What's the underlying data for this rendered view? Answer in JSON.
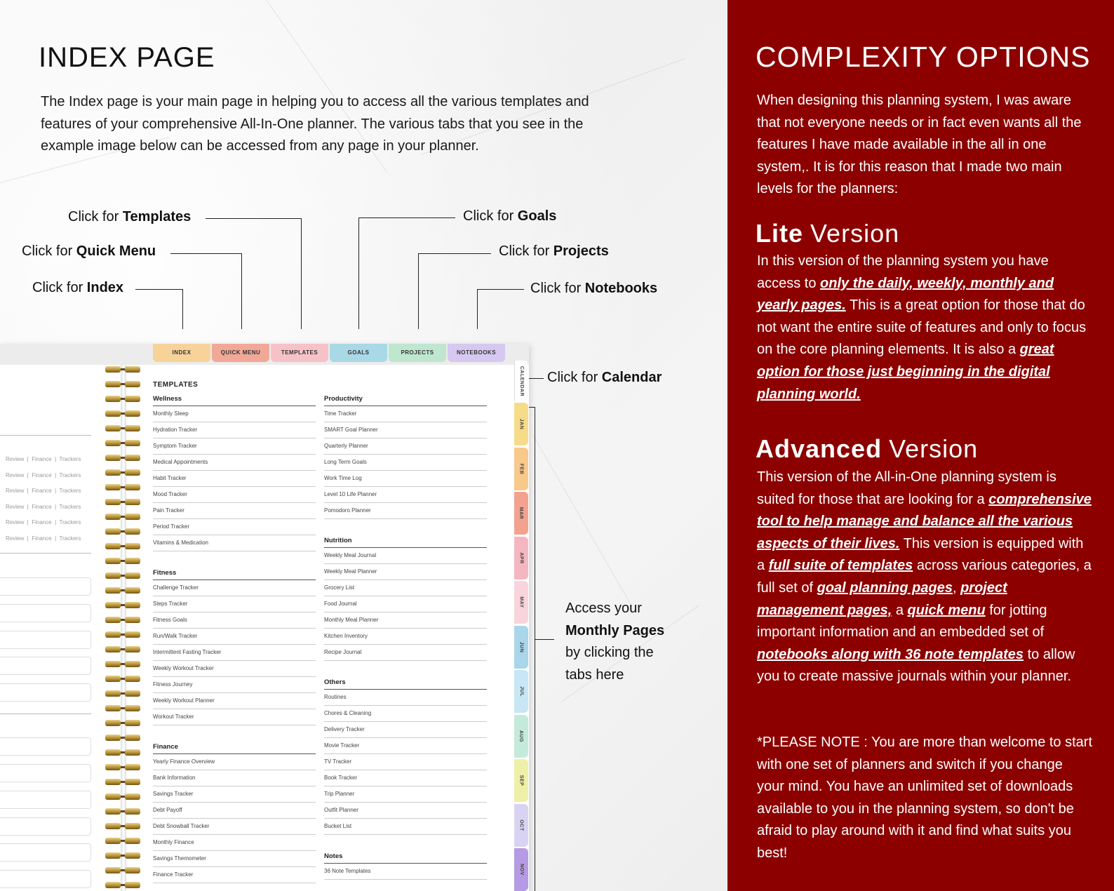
{
  "index": {
    "title": "INDEX PAGE",
    "intro": "The Index page is your main page in helping you to access all the various templates and features of your comprehensive All-In-One planner. The various tabs that you see in the example image below can be accessed from any page in your planner."
  },
  "callouts": {
    "prefix": "Click for",
    "templates": "Templates",
    "quick_menu": "Quick Menu",
    "index": "Index",
    "goals": "Goals",
    "projects": "Projects",
    "notebooks": "Notebooks",
    "calendar": "Calendar",
    "monthly_l1": "Access your",
    "monthly_l2": "Monthly Pages",
    "monthly_l3": "by clicking the",
    "monthly_l4": "tabs here"
  },
  "planner": {
    "top_tabs": [
      {
        "label": "INDEX",
        "color": "#f7d39a"
      },
      {
        "label": "QUICK MENU",
        "color": "#f2a897"
      },
      {
        "label": "TEMPLATES",
        "color": "#f6c2c8"
      },
      {
        "label": "GOALS",
        "color": "#a9d8e6"
      },
      {
        "label": "PROJECTS",
        "color": "#bfe6cf"
      },
      {
        "label": "NOTEBOOKS",
        "color": "#d6c8f0"
      }
    ],
    "side_tabs": [
      {
        "label": "CALENDAR",
        "color": "#ffffff"
      },
      {
        "label": "JAN",
        "color": "#f6dc88"
      },
      {
        "label": "FEB",
        "color": "#f8c98b"
      },
      {
        "label": "MAR",
        "color": "#f2a28f"
      },
      {
        "label": "APR",
        "color": "#f4b7c1"
      },
      {
        "label": "MAY",
        "color": "#f9d4dc"
      },
      {
        "label": "JUN",
        "color": "#a9d6ea"
      },
      {
        "label": "JUL",
        "color": "#c7e7f4"
      },
      {
        "label": "AUG",
        "color": "#c4eadb"
      },
      {
        "label": "SEP",
        "color": "#eef0a8"
      },
      {
        "label": "OCT",
        "color": "#d9d3f3"
      },
      {
        "label": "NOV",
        "color": "#b69ae3"
      }
    ],
    "left_page_row": [
      "Review",
      "Finance",
      "Trackers"
    ],
    "templates_title": "TEMPLATES",
    "col1": [
      {
        "title": "Wellness",
        "items": [
          "Monthly Sleep",
          "Hydration Tracker",
          "Symptom Tracker",
          "Medical Appointments",
          "Habit Tracker",
          "Mood Tracker",
          "Pain Tracker",
          "Period Tracker",
          "Vitamins & Medication"
        ]
      },
      {
        "title": "Fitness",
        "items": [
          "Challenge Tracker",
          "Steps Tracker",
          "Fitness Goals",
          "Run/Walk Tracker",
          "Intermittent Fasting Tracker",
          "Weekly Workout Tracker",
          "Fitness Journey",
          "Weekly Workout Planner",
          "Workout Tracker"
        ]
      },
      {
        "title": "Finance",
        "items": [
          "Yearly Finance Overview",
          "Bank Information",
          "Savings Tracker",
          "Debt Payoff",
          "Debt Snowball Tracker",
          "Monthly Finance",
          "Savings Themometer",
          "Finance Tracker"
        ]
      }
    ],
    "col2": [
      {
        "title": "Productivity",
        "items": [
          "Time Tracker",
          "SMART Goal Planner",
          "Quarterly Planner",
          "Long Term Goals",
          "Work Time Log",
          "Level 10 Life Planner",
          "Pomodoro Planner"
        ]
      },
      {
        "title": "Nutrition",
        "items": [
          "Weekly Meal Journal",
          "Weekly Meal Planner",
          "Grocery List",
          "Food Journal",
          "Monthly Meal Planner",
          "Kitchen Inventory",
          "Recipe Journal"
        ]
      },
      {
        "title": "Others",
        "items": [
          "Routines",
          "Chores & Cleaning",
          "Delivery Tracker",
          "Movie Tracker",
          "TV Tracker",
          "Book Tracker",
          "Trip Planner",
          "Outfit Planner",
          "Bucket List"
        ]
      },
      {
        "title": "Notes",
        "items": [
          "36 Note Templates"
        ]
      }
    ]
  },
  "complexity": {
    "title": "COMPLEXITY OPTIONS",
    "intro": "When designing this planning system, I was aware that not everyone needs or in fact even wants all the features I have made available in the all in one system,. It is for this reason that I made two main levels for the planners:",
    "lite_bold": "Lite",
    "lite_word": "Version",
    "lite_t1": "In this version of the planning system you have access to ",
    "lite_u1": "only the daily, weekly, monthly and yearly pages.",
    "lite_t2": " This is a great option for those that do not want the entire suite of features and only to focus on the core planning elements. It is also a ",
    "lite_u2": "great option for those just beginning in the digital planning world.",
    "adv_bold": "Advanced",
    "adv_word": "Version",
    "adv_t1": "This version of the All-in-One planning system is suited for those that are looking for a ",
    "adv_u1": "comprehensive tool to help manage and balance all the various aspects of their lives.",
    "adv_t2": " This version is equipped with a ",
    "adv_u2": "full suite of templates",
    "adv_t3": " across various categories, a full set of ",
    "adv_u3": "goal planning pages",
    "adv_t4": ", ",
    "adv_u4": "project management pages,",
    "adv_t5": " a ",
    "adv_u5": "quick menu",
    "adv_t6": " for jotting important information and an embedded set of ",
    "adv_u6": "notebooks along with 36 note templates",
    "adv_t7": " to allow you to create massive journals within your planner.",
    "note": "*PLEASE NOTE : You are more than welcome to start with one set of planners and switch if you change your mind. You have an unlimited set of downloads available to you in the planning system, so don't be afraid to play around with it and find what suits you best!"
  }
}
